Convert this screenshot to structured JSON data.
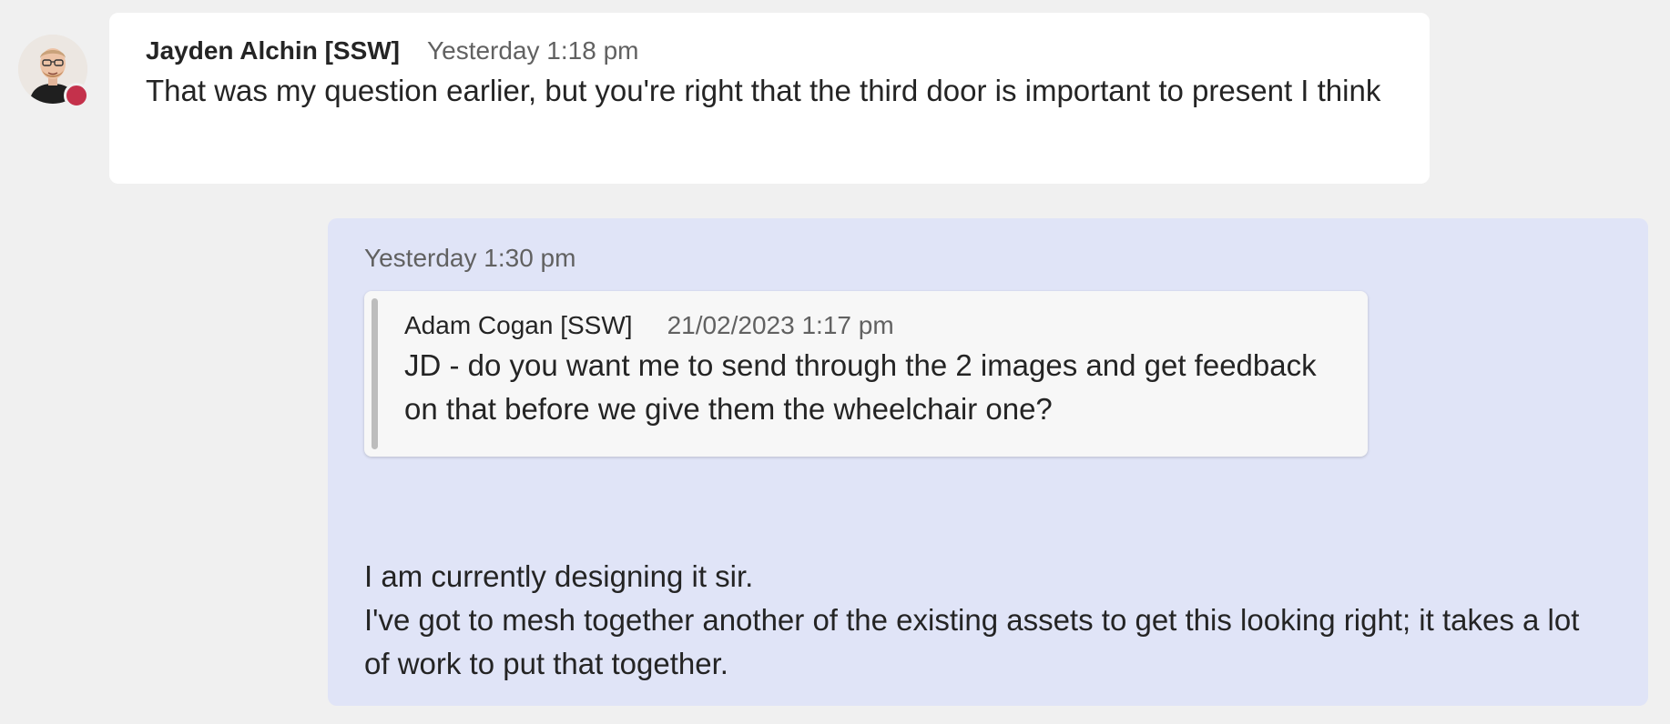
{
  "messages": {
    "incoming": {
      "sender": "Jayden Alchin [SSW]",
      "time": "Yesterday 1:18 pm",
      "text": "That was my question earlier, but you're right that the third door is important to present I think",
      "presence_color": "#c4314b"
    },
    "outgoing": {
      "time": "Yesterday 1:30 pm",
      "quote": {
        "sender": "Adam Cogan [SSW]",
        "time": "21/02/2023 1:17 pm",
        "text": "JD - do you want me to send through the 2 images and get feedback on that before we give them the wheelchair one?"
      },
      "lines": [
        "I am currently designing it sir.",
        "I've got to mesh together another of the existing assets to get this looking right; it takes a lot of work to put that together."
      ]
    }
  },
  "colors": {
    "background": "#f0f0f0",
    "incoming_bubble": "#ffffff",
    "outgoing_bubble": "#e0e4f7",
    "quote_background": "#f7f7f7"
  }
}
